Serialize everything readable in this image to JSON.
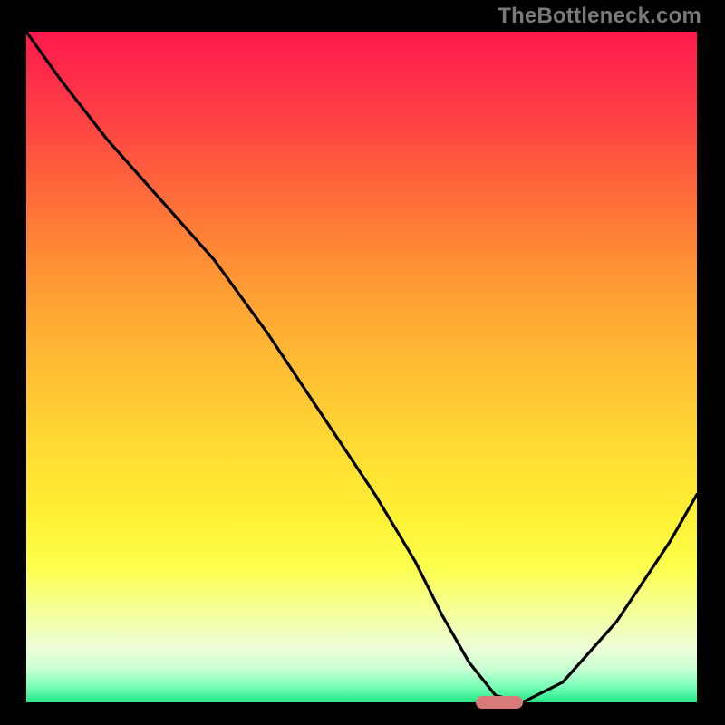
{
  "watermark": "TheBottleneck.com",
  "chart_data": {
    "type": "line",
    "title": "",
    "xlabel": "",
    "ylabel": "",
    "xlim": [
      0,
      100
    ],
    "ylim": [
      0,
      100
    ],
    "grid": false,
    "legend": false,
    "series": [
      {
        "name": "bottleneck-curve",
        "x": [
          0,
          5,
          12,
          20,
          28,
          36,
          44,
          52,
          58,
          62,
          66,
          70,
          74,
          80,
          88,
          96,
          100
        ],
        "y": [
          100,
          93,
          84,
          75,
          66,
          55,
          43,
          31,
          21,
          13,
          6,
          1,
          0,
          3,
          12,
          24,
          31
        ]
      }
    ],
    "annotations": [
      {
        "name": "optimal-marker",
        "x_start": 67,
        "x_end": 74,
        "y": 0,
        "color": "#d97a7a"
      }
    ],
    "background_gradient": {
      "top": "#ff1a4d",
      "mid": "#ffd733",
      "bottom": "#22e887"
    }
  }
}
